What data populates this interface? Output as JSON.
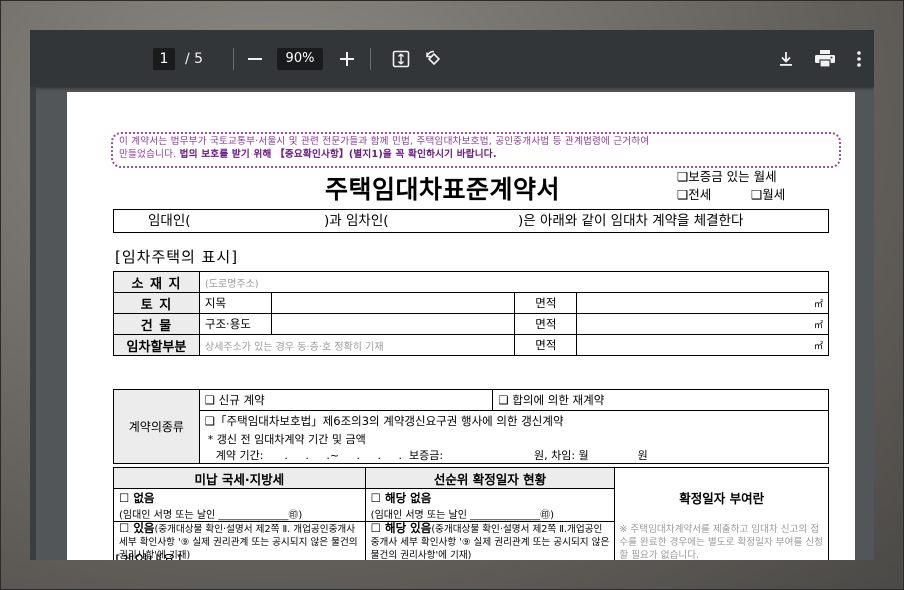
{
  "toolbar": {
    "page_current": "1",
    "page_total": "/ 5",
    "zoom": "90%",
    "icons": [
      "minus-icon",
      "plus-icon",
      "fit-page-icon",
      "rotate-icon",
      "download-icon",
      "print-icon",
      "more-vert-icon"
    ]
  },
  "document": {
    "notice_line1": "이 계약서는 법무부가 국토교통부·서울시 및 관련 전문가들과 함께 민법, 주택임대차보호법, 공인중개사법 등 관계법령에 근거하여",
    "notice_line2_prefix": "만들었습니다.",
    "notice_line2_bold": "법의 보호를 받기 위해 【중요확인사항】(별지1)을 꼭 확인하시기 바랍니다.",
    "title": "주택임대차표준계약서",
    "opt_deposit_monthly": "❑보증금 있는 월세",
    "opt_jeonse": "❑전세",
    "opt_monthly": "❑월세",
    "party_lessor": "임대인(",
    "party_and": ")과 임차인(",
    "party_rest": ")은 아래와 같이 임대차 계약을 체결한다",
    "section_title": "[임차주택의 표시]",
    "row_address_label": "소 재 지",
    "row_address_placeholder": "(도로명주소)",
    "row_land_label": "토    지",
    "row_land_sub": "지목",
    "row_building_label": "건    물",
    "row_building_sub": "구조·용도",
    "row_part_label": "임차할부분",
    "row_part_placeholder": "상세주소가 있는 경우 동·층·호 정확히 기재",
    "area_label": "면적",
    "area_unit": "㎡",
    "contract_type_label": "계약의종류",
    "ct_new": "❑ 신규 계약",
    "ct_renew_agree": "❑ 합의에 의한 재계약",
    "ct_renew_right": "❑「주택임대차보호법」제6조의3의 계약갱신요구권 행사에 의한 갱신계약",
    "ct_prev_title": "* 갱신 전 임대차계약 기간 및 금액",
    "ct_prev_line": "계약 기간:      .     .     .~     .     .     .  보증금:                          원, 차임: 월              원",
    "tax_header": "미납 국세·지방세",
    "priority_header": "선순위 확정일자 현황",
    "tax_none": "☐ 없음",
    "tax_none_sign": "(임대인 서명 또는 날인 ______________㊞)",
    "tax_exist_bold": "☐ 있음",
    "tax_exist_text": "(중개대상물 확인·설명서 제2쪽 Ⅱ. 개업공인중개사 세부 확인사항 '⑨ 실제 권리관계 또는 공시되지 않은 물건의 권리사항'에 기재)",
    "prio_none": "☐ 해당 없음",
    "prio_none_sign": "(임대인 서명 또는 날인 ______________㊞)",
    "prio_exist_bold": "☐ 해당 있음",
    "prio_exist_text": "(중개대상물 확인·설명서 제2쪽 Ⅱ.개업공인중개사 세부 확인사항 '⑨ 실제 권리관계 또는 공시되지 않은 물건의 권리사항'에 기재)",
    "fixed_date_title": "확정일자 부여란",
    "fixed_date_note": "※ 주택임대차계약서를 제출하고 임대차 신고의 접수를 완료한 경우에는 별도로 확정일자 부여를 신청할 필요가 없습니다.",
    "next_section_partial": "[계약내용]"
  }
}
